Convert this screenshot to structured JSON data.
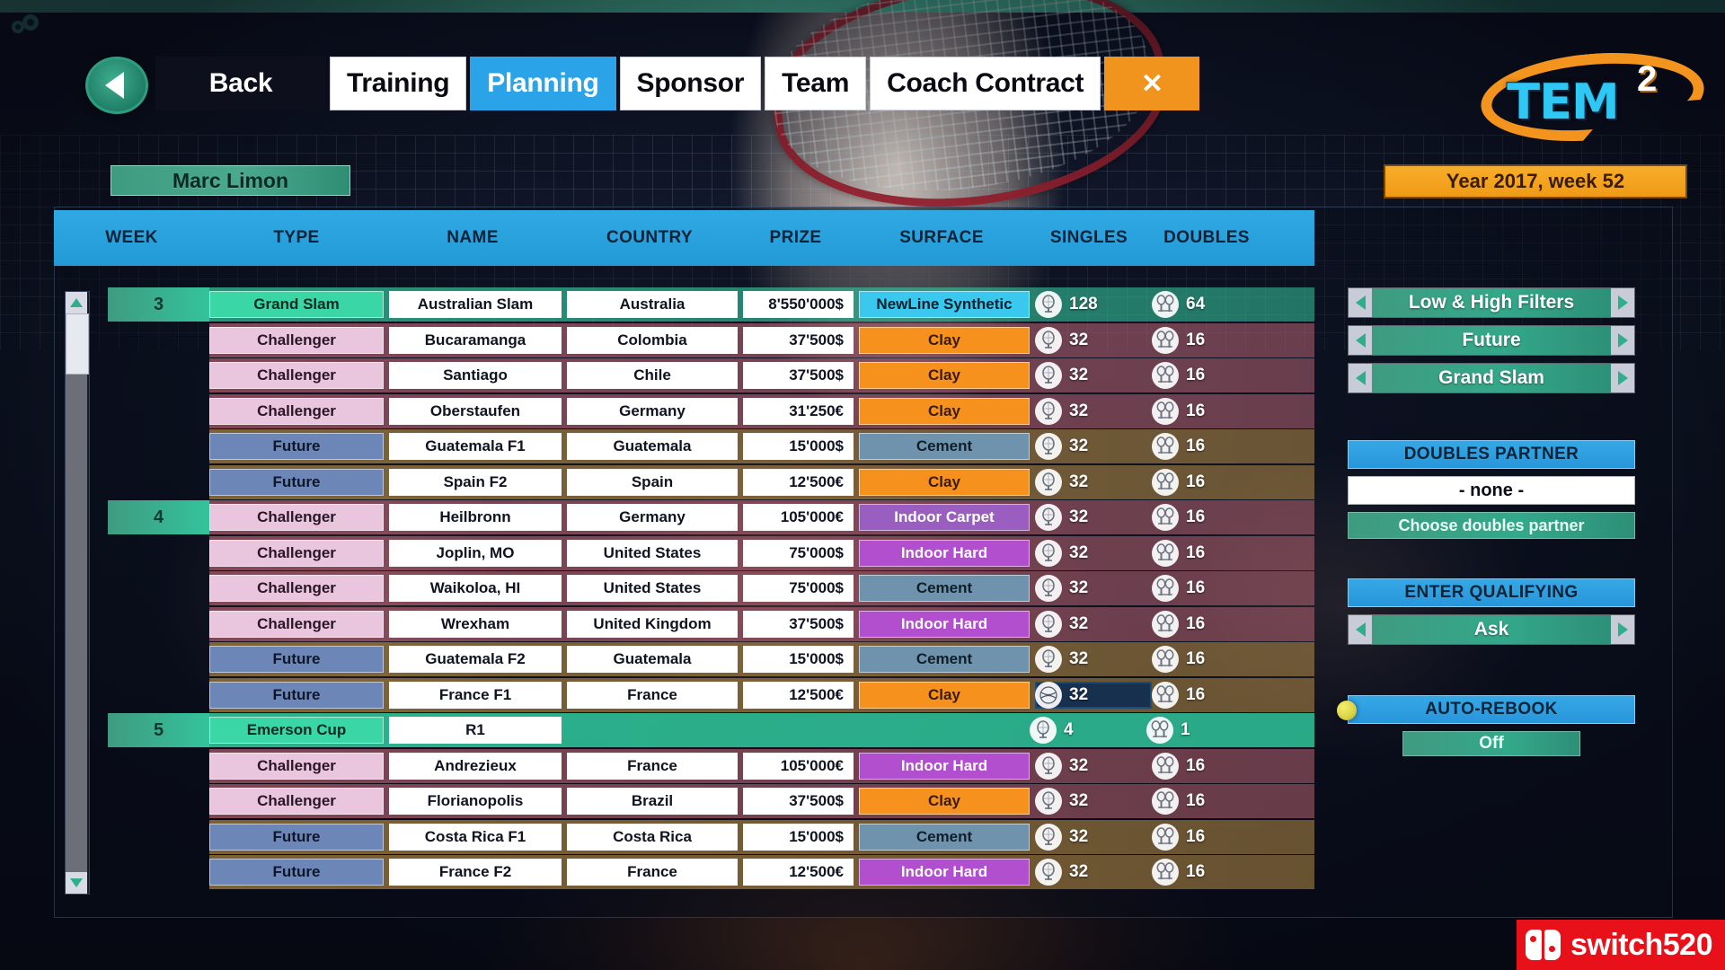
{
  "app": {
    "logo_text": "TEM",
    "logo_sup": "2",
    "gear_icon": "gear-icon"
  },
  "topnav": {
    "back_icon": "back-arrow-icon",
    "tabs": [
      {
        "label": "Back",
        "style": "dark",
        "name": "back"
      },
      {
        "label": "Training",
        "style": "plain",
        "name": "training"
      },
      {
        "label": "Planning",
        "style": "active",
        "name": "planning"
      },
      {
        "label": "Sponsor",
        "style": "plain",
        "name": "sponsor"
      },
      {
        "label": "Team",
        "style": "plain",
        "name": "team"
      },
      {
        "label": "Coach Contract",
        "style": "plain",
        "name": "coach-contract"
      },
      {
        "label": "✕",
        "style": "close",
        "name": "close"
      }
    ]
  },
  "player": {
    "name": "Marc Limon"
  },
  "date": {
    "badge": "Year 2017, week 52"
  },
  "table": {
    "columns": [
      "WEEK",
      "TYPE",
      "NAME",
      "COUNTRY",
      "PRIZE",
      "SURFACE",
      "SINGLES",
      "DOUBLES"
    ],
    "singles_icon": "racket-icon",
    "doubles_icon": "doubles-racket-icon",
    "rows": [
      {
        "week": "3",
        "type": "Grand Slam",
        "type_class": "t-grandslam",
        "band": "band-gs",
        "name": "Australian Slam",
        "country": "Australia",
        "prize": "8'550'000$",
        "surface": "NewLine Synthetic",
        "surface_class": "s-newline",
        "singles": "128",
        "doubles": "64",
        "selected": false
      },
      {
        "week": "",
        "type": "Challenger",
        "type_class": "t-challenger",
        "band": "band-ch",
        "name": "Bucaramanga",
        "country": "Colombia",
        "prize": "37'500$",
        "surface": "Clay",
        "surface_class": "s-clay",
        "singles": "32",
        "doubles": "16",
        "selected": false
      },
      {
        "week": "",
        "type": "Challenger",
        "type_class": "t-challenger",
        "band": "band-ch",
        "name": "Santiago",
        "country": "Chile",
        "prize": "37'500$",
        "surface": "Clay",
        "surface_class": "s-clay",
        "singles": "32",
        "doubles": "16",
        "selected": false
      },
      {
        "week": "",
        "type": "Challenger",
        "type_class": "t-challenger",
        "band": "band-ch",
        "name": "Oberstaufen",
        "country": "Germany",
        "prize": "31'250€",
        "surface": "Clay",
        "surface_class": "s-clay",
        "singles": "32",
        "doubles": "16",
        "selected": false
      },
      {
        "week": "",
        "type": "Future",
        "type_class": "t-future",
        "band": "band-fu",
        "name": "Guatemala F1",
        "country": "Guatemala",
        "prize": "15'000$",
        "surface": "Cement",
        "surface_class": "s-cement",
        "singles": "32",
        "doubles": "16",
        "selected": false
      },
      {
        "week": "",
        "type": "Future",
        "type_class": "t-future",
        "band": "band-fu",
        "name": "Spain F2",
        "country": "Spain",
        "prize": "12'500€",
        "surface": "Clay",
        "surface_class": "s-clay",
        "singles": "32",
        "doubles": "16",
        "selected": false
      },
      {
        "week": "4",
        "type": "Challenger",
        "type_class": "t-challenger",
        "band": "band-ch",
        "name": "Heilbronn",
        "country": "Germany",
        "prize": "105'000€",
        "surface": "Indoor Carpet",
        "surface_class": "s-indoorcarpet",
        "singles": "32",
        "doubles": "16",
        "selected": false
      },
      {
        "week": "",
        "type": "Challenger",
        "type_class": "t-challenger",
        "band": "band-ch",
        "name": "Joplin, MO",
        "country": "United States",
        "prize": "75'000$",
        "surface": "Indoor Hard",
        "surface_class": "s-indoorhard",
        "singles": "32",
        "doubles": "16",
        "selected": false
      },
      {
        "week": "",
        "type": "Challenger",
        "type_class": "t-challenger",
        "band": "band-ch",
        "name": "Waikoloa, HI",
        "country": "United States",
        "prize": "75'000$",
        "surface": "Cement",
        "surface_class": "s-cement",
        "singles": "32",
        "doubles": "16",
        "selected": false
      },
      {
        "week": "",
        "type": "Challenger",
        "type_class": "t-challenger",
        "band": "band-ch",
        "name": "Wrexham",
        "country": "United Kingdom",
        "prize": "37'500$",
        "surface": "Indoor Hard",
        "surface_class": "s-indoorhard",
        "singles": "32",
        "doubles": "16",
        "selected": false
      },
      {
        "week": "",
        "type": "Future",
        "type_class": "t-future",
        "band": "band-fu",
        "name": "Guatemala F2",
        "country": "Guatemala",
        "prize": "15'000$",
        "surface": "Cement",
        "surface_class": "s-cement",
        "singles": "32",
        "doubles": "16",
        "selected": false
      },
      {
        "week": "",
        "type": "Future",
        "type_class": "t-future",
        "band": "band-fu",
        "name": "France F1",
        "country": "France",
        "prize": "12'500€",
        "surface": "Clay",
        "surface_class": "s-clay",
        "singles": "32",
        "doubles": "16",
        "selected": true
      },
      {
        "week": "5",
        "type": "Emerson Cup",
        "type_class": "t-emerson",
        "band": "band-em",
        "name": "R1",
        "country": "",
        "prize": "",
        "surface": "",
        "surface_class": "",
        "singles": "4",
        "doubles": "1",
        "selected": false,
        "sparse": true
      },
      {
        "week": "",
        "type": "Challenger",
        "type_class": "t-challenger",
        "band": "band-ch",
        "name": "Andrezieux",
        "country": "France",
        "prize": "105'000€",
        "surface": "Indoor Hard",
        "surface_class": "s-indoorhard",
        "singles": "32",
        "doubles": "16",
        "selected": false
      },
      {
        "week": "",
        "type": "Challenger",
        "type_class": "t-challenger",
        "band": "band-ch",
        "name": "Florianopolis",
        "country": "Brazil",
        "prize": "37'500$",
        "surface": "Clay",
        "surface_class": "s-clay",
        "singles": "32",
        "doubles": "16",
        "selected": false
      },
      {
        "week": "",
        "type": "Future",
        "type_class": "t-future",
        "band": "band-fu",
        "name": "Costa Rica F1",
        "country": "Costa Rica",
        "prize": "15'000$",
        "surface": "Cement",
        "surface_class": "s-cement",
        "singles": "32",
        "doubles": "16",
        "selected": false
      },
      {
        "week": "",
        "type": "Future",
        "type_class": "t-future",
        "band": "band-fu",
        "name": "France F2",
        "country": "France",
        "prize": "12'500€",
        "surface": "Indoor Hard",
        "surface_class": "s-indoorhard",
        "singles": "32",
        "doubles": "16",
        "selected": false
      }
    ]
  },
  "sidebar": {
    "filters": [
      {
        "label": "Low & High Filters",
        "name": "low-high-filters"
      },
      {
        "label": "Future",
        "name": "future-filter"
      },
      {
        "label": "Grand Slam",
        "name": "grand-slam-filter"
      }
    ],
    "doubles_partner": {
      "header": "DOUBLES PARTNER",
      "value": "- none -",
      "choose_label": "Choose doubles partner"
    },
    "qualifying": {
      "header": "ENTER QUALIFYING",
      "value": "Ask"
    },
    "auto_rebook": {
      "header": "AUTO-REBOOK",
      "value": "Off"
    }
  },
  "watermark": {
    "text": "switch520",
    "icon": "switch-console-icon"
  }
}
